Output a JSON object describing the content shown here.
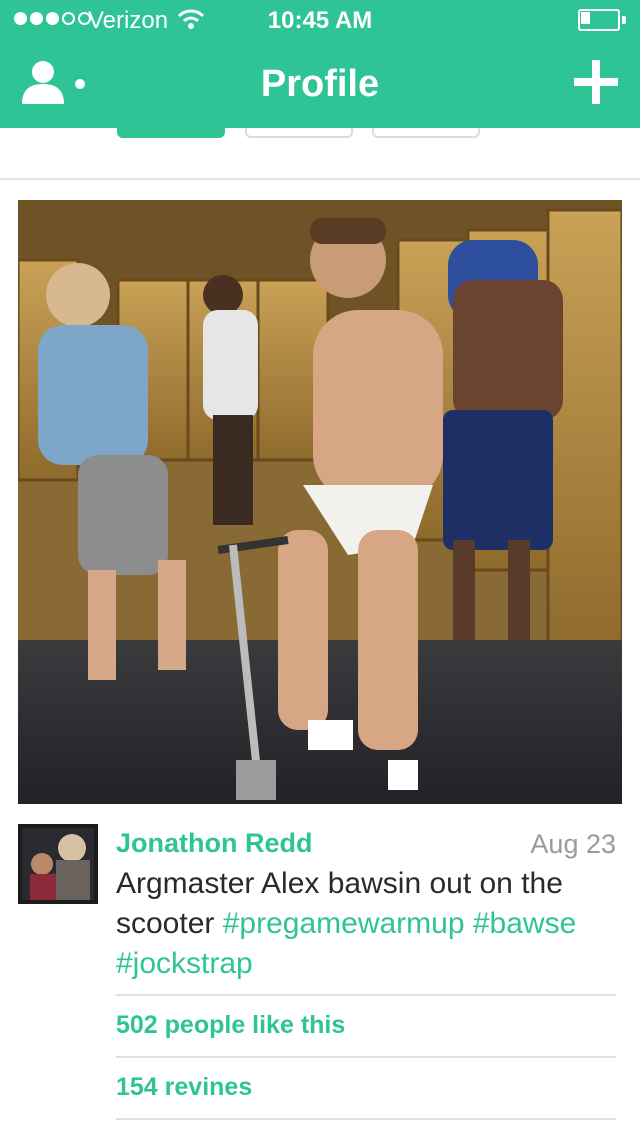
{
  "status_bar": {
    "carrier": "Verizon",
    "time": "10:45 AM",
    "signal_bars_filled": 3,
    "signal_bars_total": 5,
    "battery_level": 0.25,
    "wifi_icon": "wifi-icon"
  },
  "nav": {
    "title": "Profile",
    "left_icon": "profile-menu-icon",
    "right_icon": "plus-icon"
  },
  "post": {
    "author": "Jonathon Redd",
    "date": "Aug 23",
    "caption_text": "Argmaster Alex bawsin out on the scooter",
    "hashtags": [
      "#pregamewarmup",
      "#bawse",
      "#jockstrap"
    ],
    "likes": "502 people like this",
    "revines": "154 revines"
  },
  "colors": {
    "brand_green": "#2fc496",
    "meta_gray": "#9a9a9a",
    "text_dark": "#2a2a2a"
  }
}
